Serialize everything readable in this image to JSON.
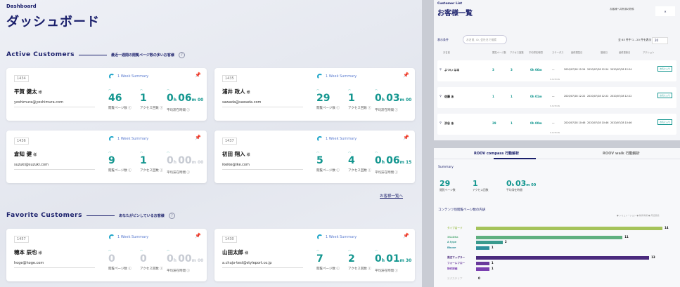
{
  "dashboard": {
    "crumb": "Dashboard",
    "title": "ダッシュボード",
    "active_heading": "Active Customers",
    "active_sub": "最近一週間の閲覧ページ数の多いお客様",
    "favorite_heading": "Favorite Customers",
    "favorite_sub": "あなたがピンしているお客様",
    "week_summary": "1 Week Summary",
    "label_pages": "閲覧ページ数",
    "label_access": "アクセス回数",
    "label_time": "平均滞在時間",
    "honorific": "様",
    "more_link": "お客様一覧へ",
    "active": [
      {
        "id": "1434",
        "name": "平賀 健太",
        "email": "yoshimura@yoshimura.com",
        "pages": "46",
        "access": "1",
        "h": "0",
        "m": "06",
        "s": "00",
        "dim": false
      },
      {
        "id": "1435",
        "name": "浦井 政人",
        "email": "sawada@sawada.com",
        "pages": "29",
        "access": "1",
        "h": "0",
        "m": "03",
        "s": "00",
        "dim": false
      },
      {
        "id": "1436",
        "name": "倉知 健",
        "email": "suzuki@suzuki.com",
        "pages": "9",
        "access": "1",
        "h": "0",
        "m": "00",
        "s": "00",
        "dim": true
      },
      {
        "id": "1437",
        "name": "初田 翔入",
        "email": "ikeike@ike.com",
        "pages": "5",
        "access": "4",
        "h": "0",
        "m": "06",
        "s": "15",
        "dim": false
      }
    ],
    "favorites": [
      {
        "id": "1457",
        "name": "穂本 辰也",
        "email": "hoge@hoge.com",
        "pages": "0",
        "access": "0",
        "h": "0",
        "m": "00",
        "s": "00",
        "dim": true
      },
      {
        "id": "1430",
        "name": "山田太郎",
        "email": "a.chujo-test@styleport.co.jp",
        "pages": "7",
        "access": "2",
        "h": "0",
        "m": "01",
        "s": "30",
        "dim": false
      }
    ]
  },
  "customer_list": {
    "crumb": "Customer List",
    "title": "お客様一覧",
    "note": "お客様へ共有済の物件",
    "close_label": "✕",
    "filter_label": "表示条件",
    "search_placeholder": "お名前, ID, 会社名で検索",
    "count_text": "全 63 件中 1 - 20 件を表示",
    "per_page": "20",
    "columns": [
      "お名前",
      "閲覧ページ数",
      "アクセス回数",
      "平均滞在時間",
      "ステータス",
      "最終閲覧日",
      "登録日",
      "最終更新日",
      "アクション"
    ],
    "rows": [
      {
        "name": "よつい はる",
        "pages": "3",
        "access": "3",
        "time": "0h 06m",
        "status": "―",
        "last": "2020/07/28 12:24",
        "reg": "2020/07/28 12:24",
        "upd": "2020/07/28 12:24",
        "action": "お気に入り"
      },
      {
        "name": "佐藤 あ",
        "pages": "1",
        "access": "1",
        "time": "0h 01m",
        "status": "―",
        "last": "2020/07/28 12:22",
        "reg": "2020/07/28 12:22",
        "upd": "2020/07/28 12:22",
        "action": "お気に入り"
      },
      {
        "name": "渋谷 あ",
        "pages": "29",
        "access": "1",
        "time": "0h 00m",
        "status": "―",
        "last": "2020/07/28 10:46",
        "reg": "2020/07/28 10:46",
        "upd": "2020/07/28 10:46",
        "action": "お気に入り"
      }
    ],
    "action_row_label": "ACTION"
  },
  "analysis": {
    "tab1": "ROOV compass 行動解析",
    "tab2": "ROOV walk 行動解析",
    "summary_label": "Summary",
    "pages": "29",
    "access": "1",
    "h": "0",
    "m": "03",
    "s": "00",
    "label_pages": "閲覧ページ数",
    "label_access": "アクセス回数",
    "label_time": "平均滞在時間",
    "chart_title": "コンテンツ別閲覧ページ数の内訳",
    "legend": "● シミュレーション  ● 物件情報  ● 周辺環境"
  },
  "chart_data": {
    "type": "bar",
    "title": "コンテンツ別閲覧ページ数の内訳",
    "categories": [
      "タイプ名ード",
      "3SLDKa",
      "A type",
      "Bbuse",
      "周辺マッグラー",
      "フォールフロー",
      "物件詳細",
      "エクステリア"
    ],
    "values": [
      14,
      11,
      2,
      1,
      13,
      1,
      1,
      0
    ],
    "colors": [
      "#a5c35a",
      "#5fb080",
      "#3a9a8e",
      "#2e8f9c",
      "#4a2a7d",
      "#6a3a9c",
      "#7a3fb0",
      "#ccc"
    ],
    "xlim": [
      0,
      14
    ]
  },
  "colors": {
    "accent": "#13968f",
    "navy": "#1a1f6b"
  }
}
